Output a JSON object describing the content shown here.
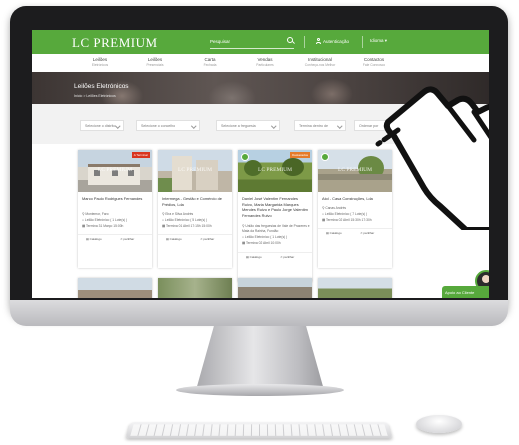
{
  "header": {
    "logo": "LC PREMIUM",
    "search_placeholder": "Pesquisar",
    "auth_label": "Autenticação",
    "language_label": "Idioma ▾"
  },
  "nav": [
    {
      "label": "Leilões",
      "sub": "Eletrónicos"
    },
    {
      "label": "Leilões",
      "sub": "Presenciais"
    },
    {
      "label": "Carta",
      "sub": "Fechada"
    },
    {
      "label": "Vendas",
      "sub": "Particulares"
    },
    {
      "label": "Institucional",
      "sub": "Conheça-nos Melhor"
    },
    {
      "label": "Contactos",
      "sub": "Fale Connosco"
    }
  ],
  "hero": {
    "title": "Leilões Eletrónicos",
    "breadcrumb": "Início  >  Leilões Eletrónicos"
  },
  "filters": [
    "Selecione o distrito",
    "Selecione o concelho",
    "Selecione a freguesia",
    "Termina dentro de",
    "Ordenar por"
  ],
  "cards": [
    {
      "title": "Marco Paulo Rodrigues Fernandes",
      "badge": "A Terminar",
      "location": "Montemor, Faro",
      "auction": "Leilão Eletrónico ( 1 Lote(s) )",
      "ends": "Termina 31 Março 15:00h",
      "catalog": "Catálogo",
      "share": "partilhar"
    },
    {
      "title": "Intermega - Gestão e Comércio de Prédios, Lda",
      "badge": "",
      "location": "Eira e Silva Andrés",
      "auction": "Leilão Eletrónico ( 5 Lote(s) )",
      "ends": "Termina 01 Abril 17:15h 15:00h",
      "catalog": "Catálogo",
      "share": "partilhar"
    },
    {
      "title": "Daniel José Valentim Fernandes Ruivo, Maria Margarida Marques Mendes Ruivo e Paulo Jorge Valentim Fernandes Ruivo",
      "badge": "Destacados",
      "location": "União das freguesias de Vale de Prazeres e Mata da Rainha, Fundão",
      "auction": "Leilão Eletrónico ( 1 Lote(s) )",
      "ends": "Termina 02 Abril 10:00h",
      "catalog": "Catálogo",
      "share": "partilhar"
    },
    {
      "title": "Atol - Casa Construções, Lda",
      "badge": "",
      "location": "Canas Andrés",
      "auction": "Leilão Eletrónico ( 7 Lote(s) )",
      "ends": "Termina 02 Abril 15:30h 17:30h",
      "catalog": "Catálogo",
      "share": "partilhar"
    }
  ],
  "help": {
    "label": "Apoio ao Cliente"
  },
  "colors": {
    "brand_green": "#57a93c",
    "badge_red": "#d9341f",
    "badge_orange": "#e57b2b",
    "bezel": "#1c1c1e"
  }
}
